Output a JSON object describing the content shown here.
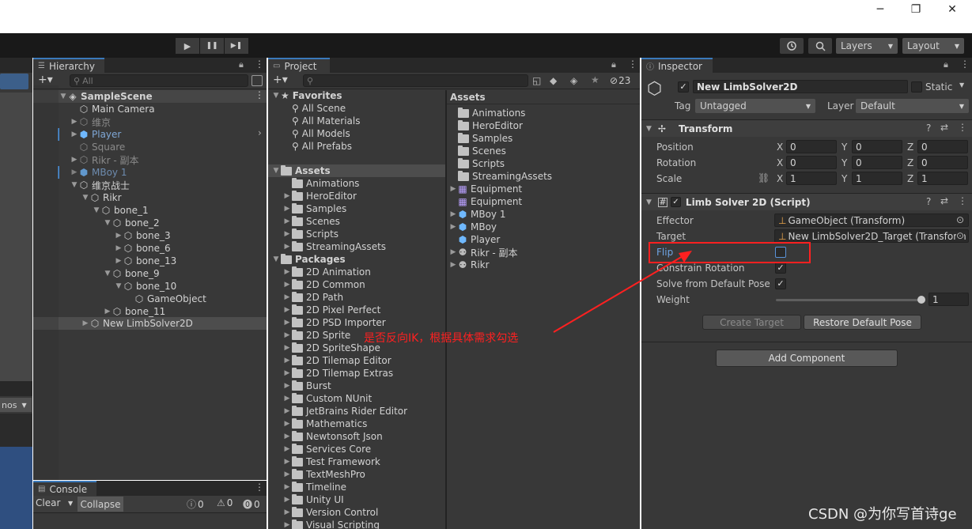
{
  "window": {
    "minimize": "─",
    "restore": "❐",
    "close": "✕"
  },
  "toolbar": {
    "play": "▶",
    "pause": "❚❚",
    "step": "▶❚",
    "layers": "Layers",
    "layout": "Layout"
  },
  "hierarchy": {
    "tab": "Hierarchy",
    "search_placeholder": "All",
    "scene": "SampleScene",
    "items": [
      {
        "label": "Main Camera"
      },
      {
        "label": "维京"
      },
      {
        "label": "Player"
      },
      {
        "label": "Square"
      },
      {
        "label": "Rikr - 副本"
      },
      {
        "label": "MBoy 1"
      },
      {
        "label": "维京战士"
      },
      {
        "label": "Rikr"
      },
      {
        "label": "bone_1"
      },
      {
        "label": "bone_2"
      },
      {
        "label": "bone_3"
      },
      {
        "label": "bone_6"
      },
      {
        "label": "bone_13"
      },
      {
        "label": "bone_9"
      },
      {
        "label": "bone_10"
      },
      {
        "label": "GameObject"
      },
      {
        "label": "bone_11"
      },
      {
        "label": "New LimbSolver2D"
      }
    ]
  },
  "project": {
    "tab": "Project",
    "count": "23",
    "favorites_label": "Favorites",
    "favorites": [
      "All Scene",
      "All Materials",
      "All Models",
      "All Prefabs"
    ],
    "assets_label": "Assets",
    "assets_folders": [
      "Animations",
      "HeroEditor",
      "Samples",
      "Scenes",
      "Scripts",
      "StreamingAssets"
    ],
    "packages_label": "Packages",
    "packages": [
      "2D Animation",
      "2D Common",
      "2D Path",
      "2D Pixel Perfect",
      "2D PSD Importer",
      "2D Sprite",
      "2D SpriteShape",
      "2D Tilemap Editor",
      "2D Tilemap Extras",
      "Burst",
      "Custom NUnit",
      "JetBrains Rider Editor",
      "Mathematics",
      "Newtonsoft Json",
      "Services Core",
      "Test Framework",
      "TextMeshPro",
      "Timeline",
      "Unity UI",
      "Version Control",
      "Visual Scripting"
    ],
    "right_header": "Assets",
    "right_items": [
      "Animations",
      "HeroEditor",
      "Samples",
      "Scenes",
      "Scripts",
      "StreamingAssets",
      "Equipment",
      "Equipment",
      "MBoy 1",
      "MBoy",
      "Player",
      "Rikr - 副本",
      "Rikr"
    ]
  },
  "console": {
    "tab": "Console",
    "clear": "Clear",
    "collapse": "Collapse",
    "info": "0",
    "warn": "0",
    "error": "0"
  },
  "left_strip": {
    "label": "nos"
  },
  "inspector": {
    "tab": "Inspector",
    "name": "New LimbSolver2D",
    "static": "Static",
    "tag_label": "Tag",
    "tag": "Untagged",
    "layer_label": "Layer",
    "layer": "Default",
    "transform": {
      "title": "Transform",
      "position": {
        "label": "Position",
        "x": "0",
        "y": "0",
        "z": "0"
      },
      "rotation": {
        "label": "Rotation",
        "x": "0",
        "y": "0",
        "z": "0"
      },
      "scale": {
        "label": "Scale",
        "x": "1",
        "y": "1",
        "z": "1"
      }
    },
    "limb": {
      "title": "Limb Solver 2D (Script)",
      "effector_label": "Effector",
      "effector": "GameObject (Transform)",
      "target_label": "Target",
      "target": "New LimbSolver2D_Target (Transform",
      "flip_label": "Flip",
      "constrain_label": "Constrain Rotation",
      "solve_label": "Solve from Default Pose",
      "weight_label": "Weight",
      "weight": "1",
      "create_target": "Create Target",
      "restore_pose": "Restore Default Pose"
    },
    "add_component": "Add Component"
  },
  "annotation": "是否反向IK，根据具体需求勾选",
  "watermark": "CSDN @为你写首诗ge",
  "colors": {
    "accent": "#3a79bb",
    "annotation": "#ff2020"
  }
}
